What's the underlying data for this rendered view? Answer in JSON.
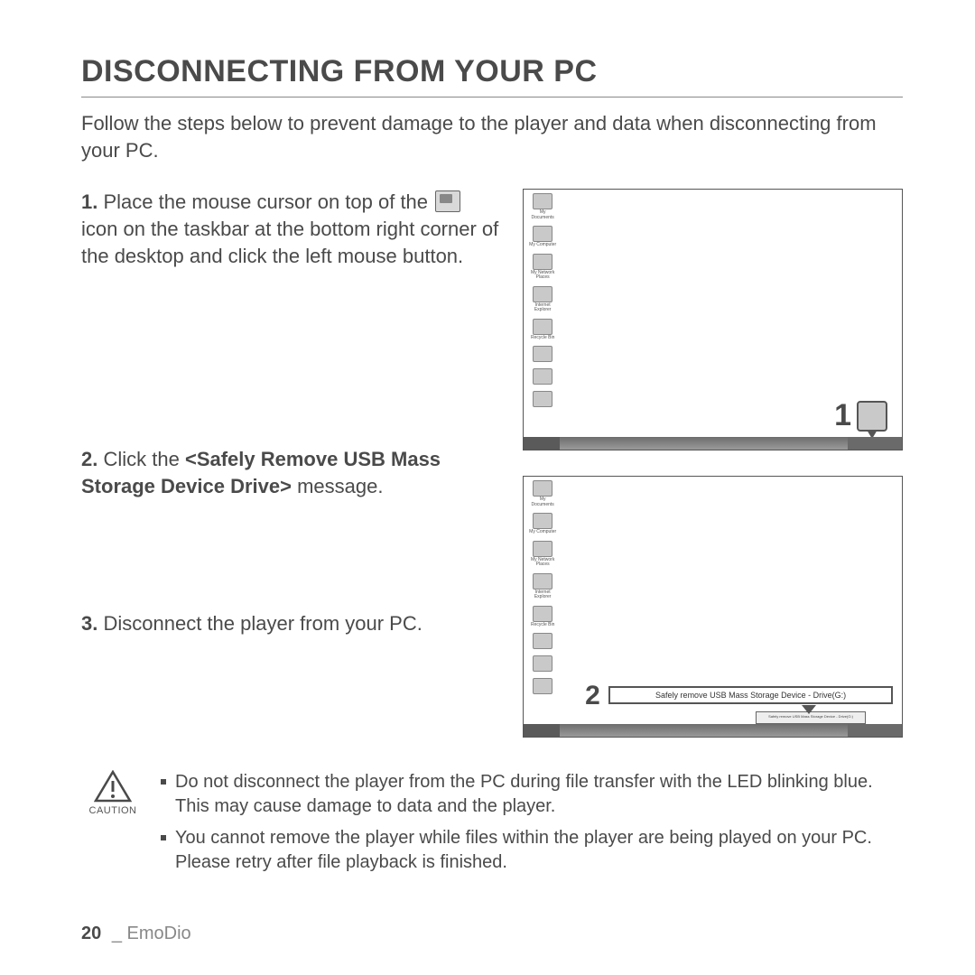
{
  "title": "DISCONNECTING FROM YOUR PC",
  "intro": "Follow the steps below to prevent damage to the player and data when disconnecting from your PC.",
  "steps": {
    "s1": {
      "num": "1.",
      "part1": "Place the mouse cursor on top of the",
      "part2": "icon on the taskbar at the bottom right corner of the desktop and click the left mouse button."
    },
    "s2": {
      "num": "2.",
      "pre": "Click the ",
      "bold": "<Safely Remove USB Mass Storage Device Drive>",
      "post": " message."
    },
    "s3": {
      "num": "3.",
      "text": "Disconnect the player from your PC."
    }
  },
  "figures": {
    "callout1": "1",
    "callout2": "2",
    "popup_text": "Safely remove USB Mass Storage Device - Drive(G:)",
    "taskbar_tooltip": "Safely remove USB Mass Storage Device - Drive(G:)",
    "desktop_icons": [
      "My Documents",
      "My Computer",
      "My Network Places",
      "Internet Explorer",
      "Recycle Bin",
      "",
      "",
      ""
    ]
  },
  "caution": {
    "label": "CAUTION",
    "items": [
      "Do not disconnect the player from the PC during file transfer with the LED blinking blue. This may cause damage to data and the player.",
      "You cannot remove the player while files within the player are being played on your PC. Please retry after file playback is finished."
    ]
  },
  "footer": {
    "page": "20",
    "sep": "_",
    "section": "EmoDio"
  }
}
